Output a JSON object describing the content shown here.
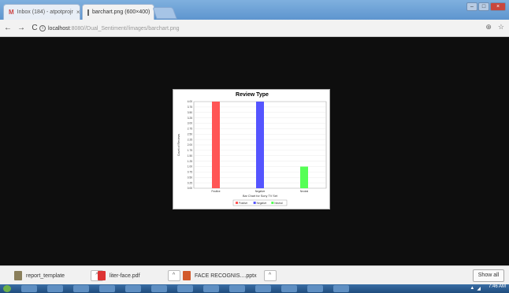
{
  "tabs": [
    {
      "title": "Inbox (184) - atpotprojr",
      "icon": "gmail-icon"
    },
    {
      "title": "barchart.png (600×400)",
      "icon": "image-icon"
    }
  ],
  "omnibox": {
    "host": "localhost",
    "rest": ":8080//Dual_Sentiment//images/barchart.png"
  },
  "chart_data": {
    "type": "bar",
    "title": "Review Type",
    "xlabel": "Bar Chart for Sony TV Set",
    "ylabel": "Count of Reviews",
    "categories": [
      "Positive",
      "Negative",
      "Neutral"
    ],
    "series": [
      {
        "name": "Positive",
        "values": [
          4.0,
          0,
          0
        ],
        "color": "#ff5555"
      },
      {
        "name": "Negative",
        "values": [
          0,
          4.0,
          0
        ],
        "color": "#5555ff"
      },
      {
        "name": "Neutral",
        "values": [
          0,
          0,
          1.0
        ],
        "color": "#55ff55"
      }
    ],
    "values": [
      4.0,
      4.0,
      1.0
    ],
    "colors": [
      "#ff5555",
      "#5555ff",
      "#55ff55"
    ],
    "ylim": [
      0,
      4.0
    ],
    "yticks": [
      "0.00",
      "0.25",
      "0.50",
      "0.75",
      "1.00",
      "1.25",
      "1.50",
      "1.75",
      "2.00",
      "2.25",
      "2.50",
      "2.75",
      "3.00",
      "3.25",
      "3.50",
      "3.75",
      "4.00"
    ],
    "legend": [
      "Positive",
      "Negative",
      "Neutral"
    ],
    "grid": true,
    "legend_position": "bottom"
  },
  "downloads": [
    {
      "name": "report_template",
      "icon": "archive-icon"
    },
    {
      "name": "liter-face.pdf",
      "icon": "pdf-icon"
    },
    {
      "name": "FACE RECOGNIS....pptx",
      "icon": "pptx-icon"
    }
  ],
  "show_all": "Show all",
  "clock": "7:46 AM"
}
